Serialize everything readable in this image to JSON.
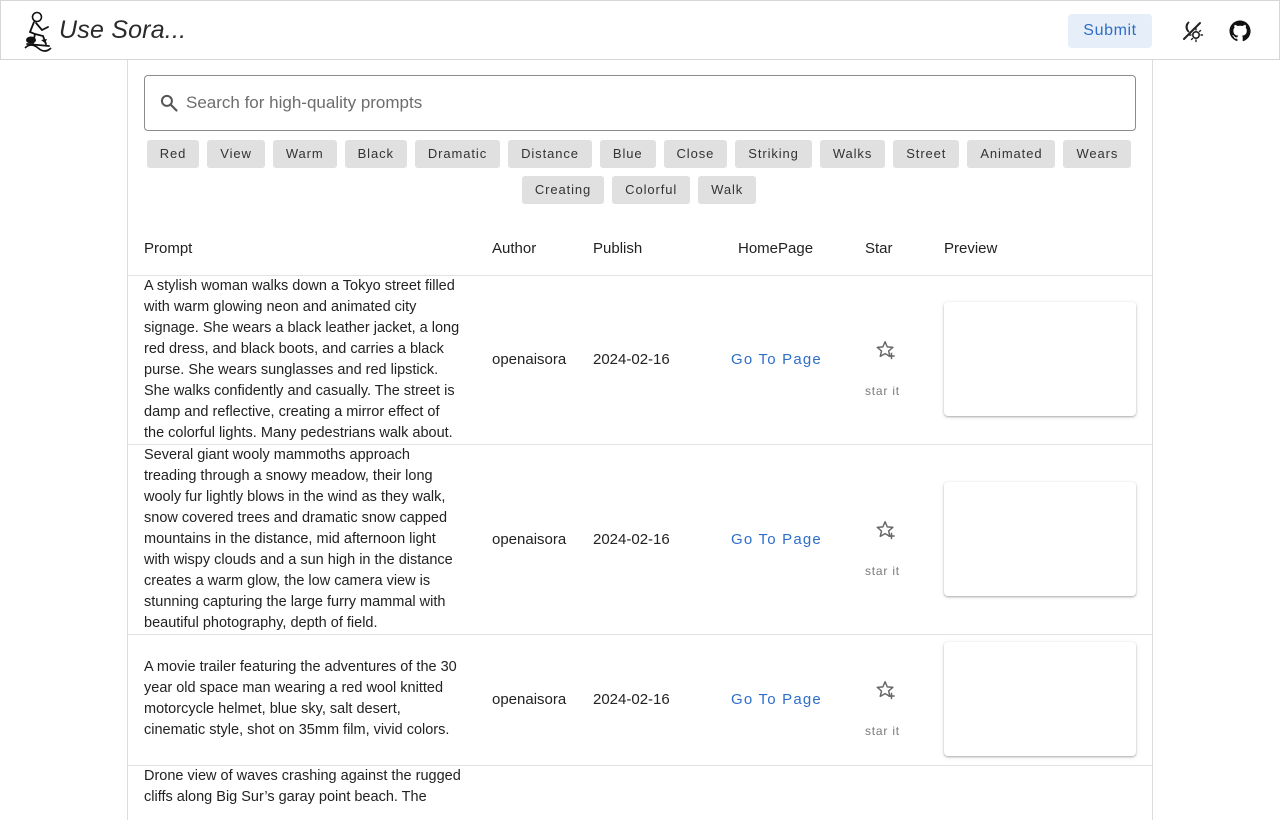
{
  "header": {
    "title": "Use Sora...",
    "submit_label": "Submit",
    "icons": [
      "logo-icon",
      "theme-toggle-icon",
      "github-icon"
    ]
  },
  "search": {
    "placeholder": "Search for high-quality prompts",
    "value": ""
  },
  "tags": [
    "Red",
    "View",
    "Warm",
    "Black",
    "Dramatic",
    "Distance",
    "Blue",
    "Close",
    "Striking",
    "Walks",
    "Street",
    "Animated",
    "Wears",
    "Creating",
    "Colorful",
    "Walk"
  ],
  "table": {
    "columns": [
      "Prompt",
      "Author",
      "Publish",
      "HomePage",
      "Star",
      "Preview"
    ],
    "rows": [
      {
        "prompt": "A stylish woman walks down a Tokyo street filled with warm glowing neon and animated city signage. She wears a black leather jacket, a long red dress, and black boots, and carries a black purse. She wears sunglasses and red lipstick. She walks confidently and casually. The street is damp and reflective, creating a mirror effect of the colorful lights. Many pedestrians walk about.",
        "author": "openaisora",
        "publish": "2024-02-16",
        "homepage": "Go To Page",
        "star": "star it"
      },
      {
        "prompt": "Several giant wooly mammoths approach treading through a snowy meadow, their long wooly fur lightly blows in the wind as they walk, snow covered trees and dramatic snow capped mountains in the distance, mid afternoon light with wispy clouds and a sun high in the distance creates a warm glow, the low camera view is stunning capturing the large furry mammal with beautiful photography, depth of field.",
        "author": "openaisora",
        "publish": "2024-02-16",
        "homepage": "Go To Page",
        "star": "star it"
      },
      {
        "prompt": "A movie trailer featuring the adventures of the 30 year old space man wearing a red wool knitted motorcycle helmet, blue sky, salt desert, cinematic style, shot on 35mm film, vivid colors.",
        "author": "openaisora",
        "publish": "2024-02-16",
        "homepage": "Go To Page",
        "star": "star it"
      },
      {
        "prompt": "Drone view of waves crashing against the rugged cliffs along Big Sur’s garay point beach. The",
        "author": "",
        "publish": "",
        "homepage": "",
        "star": ""
      }
    ]
  },
  "colors": {
    "accent": "#2f6ec7",
    "submit_bg": "#e6eef9",
    "tag_bg": "#e0e0e0",
    "border": "#dcdcdc"
  }
}
